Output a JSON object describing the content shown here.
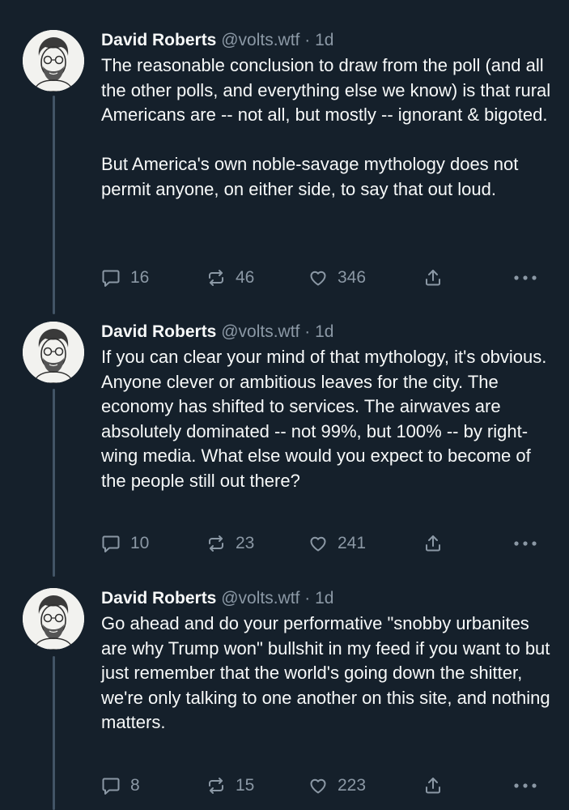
{
  "tweets": [
    {
      "author": "David Roberts",
      "handle": "@volts.wtf",
      "separator": "·",
      "time": "1d",
      "paragraphs": [
        "The reasonable conclusion to draw from the poll (and all the other polls, and everything else we know) is that rural Americans are -- not all, but mostly -- ignorant & bigoted.",
        "But America's own noble-savage mythology does not permit anyone, on either side, to say that out loud."
      ],
      "replies": "16",
      "reposts": "46",
      "likes": "346"
    },
    {
      "author": "David Roberts",
      "handle": "@volts.wtf",
      "separator": "·",
      "time": "1d",
      "paragraphs": [
        "If you can clear your mind of that mythology, it's obvious. Anyone clever or ambitious leaves for the city. The economy has shifted to services. The airwaves are absolutely dominated -- not 99%, but 100% -- by right-wing media. What else would you expect to become of the people still out there?"
      ],
      "replies": "10",
      "reposts": "23",
      "likes": "241"
    },
    {
      "author": "David Roberts",
      "handle": "@volts.wtf",
      "separator": "·",
      "time": "1d",
      "paragraphs": [
        "Go ahead and do your performative \"snobby urbanites are why Trump won\" bullshit in my feed if you want to but just remember that the world's going down the shitter, we're only talking to one another on this site, and nothing matters."
      ],
      "replies": "8",
      "reposts": "15",
      "likes": "223"
    }
  ],
  "icons": {
    "reply": "reply-icon",
    "repost": "repost-icon",
    "like": "heart-icon",
    "share": "share-icon",
    "more": "more-icon"
  },
  "colors": {
    "background": "#15202b",
    "text": "#f7f9f9",
    "muted": "#8b98a5",
    "thread_line": "#425466"
  }
}
